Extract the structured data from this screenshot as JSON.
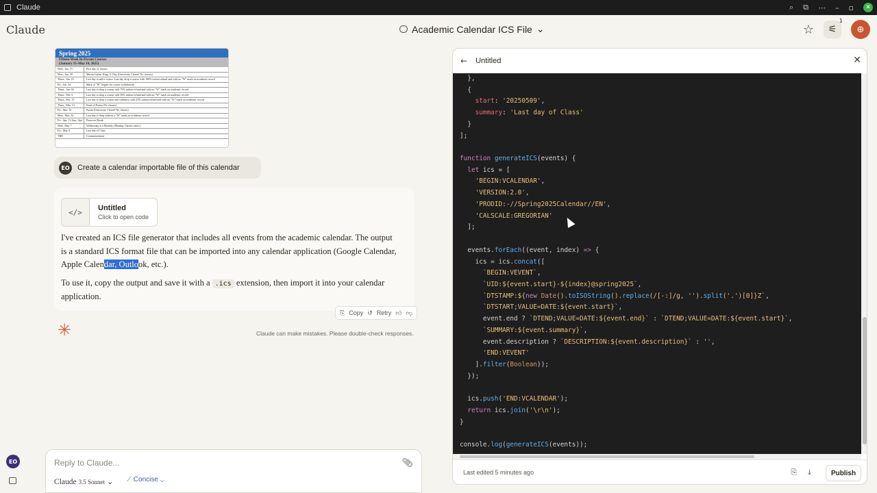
{
  "window": {
    "title": "Claude"
  },
  "header": {
    "brand": "Claude",
    "chat_title": "Academic Calendar ICS File",
    "badge_count": "1"
  },
  "calendar_image": {
    "heading": "Spring 2025",
    "subheading": "Fifteen-Week In-Person Courses",
    "date_range": "(January 15–May 10, 2025)",
    "rows": [
      {
        "date": "Wed., Jan. 15",
        "event": "First day of classes"
      },
      {
        "date": "Mon., Jan. 20",
        "event": "Martin Luther King, Jr. Day (University Closed/ No classes)"
      },
      {
        "date": "Thurs., Jan. 23",
        "event": "Last day to add a course. Last day drop a course with 100% tuition refund and with no \"W\" mark on academic record"
      },
      {
        "date": "Fri., Jan. 24",
        "event": "Mark of \"W\" begins for course withdrawals"
      },
      {
        "date": "Thurs., Jan. 30",
        "event": "Last day to drop a course with 75% tuition refund and with no \"W\" mark on academic record"
      },
      {
        "date": "Thurs., Feb. 6",
        "event": "Last day to drop a course with 50% tuition refund and with no \"W\" mark on academic record"
      },
      {
        "date": "Thurs., Feb. 13",
        "event": "Last day to drop a course and withdraw with 25% tuition refund and with no \"W\" mark on academic record"
      },
      {
        "date": "Thurs., Mar. 13",
        "event": "Feast of Purim (No classes)"
      },
      {
        "date": "Fri., Mar. 14",
        "event": "Purim (University Closed/ No classes)"
      },
      {
        "date": "Mon., Mar. 24",
        "event": "Last day to drop without a \"W\" mark on academic record"
      },
      {
        "date": "Fri., Apr. 11-Sun., Apr. 20",
        "event": "Passover Break"
      },
      {
        "date": "Wed., May 7",
        "event": "Wednesday is a Monday (Monday Classes meet.)"
      },
      {
        "date": "Fri., May 9",
        "event": "Last day of Class"
      },
      {
        "date": "TBD",
        "event": "Commencement"
      }
    ]
  },
  "user_message": {
    "initials": "EO",
    "text": "Create a calendar importable file of this calendar"
  },
  "artifact_card": {
    "title": "Untitled",
    "subtitle": "Click to open code"
  },
  "bot_message": {
    "p1_before": "I've created an ICS file generator that includes all events from the academic calendar. The output is a standard ICS format file that can be imported into any calendar application (Google Calendar, Apple Calen",
    "p1_highlight": "dar, Outlo",
    "p1_after": "ok, etc.).",
    "p2_before": "To use it, copy the output and save it with a ",
    "p2_code": ".ics",
    "p2_after": " extension, then import it into your calendar application."
  },
  "actions": {
    "copy": "Copy",
    "retry": "Retry"
  },
  "disclaimer": "Claude can make mistakes. Please double-check responses.",
  "sidebar": {
    "avatar_initials": "EO"
  },
  "composer": {
    "placeholder": "Reply to Claude...",
    "model_name": "Claude",
    "model_version": "3.5 Sonnet",
    "style": "Concise"
  },
  "artifact_panel": {
    "title": "Untitled",
    "last_edited": "Last edited 5 minutes ago",
    "publish": "Publish"
  },
  "colors": {
    "accent": "#c9562f",
    "highlight": "#2f6cd6",
    "code_bg": "#1e1e1e"
  }
}
